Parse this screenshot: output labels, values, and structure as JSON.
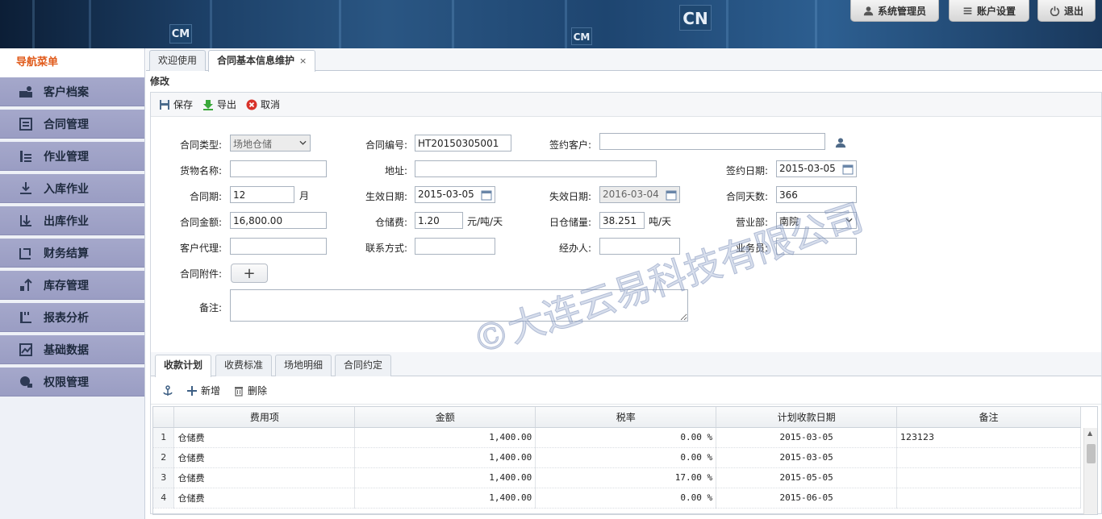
{
  "header": {
    "user_label": "系统管理员",
    "settings_label": "账户设置",
    "logout_label": "退出",
    "banner_marks": [
      "CN",
      "CM",
      "CM"
    ]
  },
  "sidebar": {
    "title": "导航菜单",
    "items": [
      {
        "label": "客户档案",
        "icon": "customer-icon"
      },
      {
        "label": "合同管理",
        "icon": "contract-icon"
      },
      {
        "label": "作业管理",
        "icon": "operation-icon"
      },
      {
        "label": "入库作业",
        "icon": "inbound-icon"
      },
      {
        "label": "出库作业",
        "icon": "outbound-icon"
      },
      {
        "label": "财务结算",
        "icon": "finance-icon"
      },
      {
        "label": "库存管理",
        "icon": "inventory-icon"
      },
      {
        "label": "报表分析",
        "icon": "report-icon"
      },
      {
        "label": "基础数据",
        "icon": "basedata-icon"
      },
      {
        "label": "权限管理",
        "icon": "permission-icon"
      }
    ]
  },
  "tabs": [
    {
      "label": "欢迎使用",
      "active": false
    },
    {
      "label": "合同基本信息维护",
      "active": true,
      "close": "×"
    }
  ],
  "panel_title": "修改",
  "toolbar": {
    "save": "保存",
    "export": "导出",
    "cancel": "取消"
  },
  "form": {
    "contract_type_label": "合同类型:",
    "contract_type_value": "场地仓储",
    "contract_no_label": "合同编号:",
    "contract_no_value": "HT20150305001",
    "customer_label": "签约客户:",
    "customer_value": "",
    "goods_label": "货物名称:",
    "goods_value": "",
    "address_label": "地址:",
    "address_value": "",
    "sign_date_label": "签约日期:",
    "sign_date_value": "2015-03-05",
    "period_label": "合同期:",
    "period_value": "12",
    "period_unit": "月",
    "effective_label": "生效日期:",
    "effective_value": "2015-03-05",
    "expire_label": "失效日期:",
    "expire_value": "2016-03-04",
    "days_label": "合同天数:",
    "days_value": "366",
    "amount_label": "合同金额:",
    "amount_value": "16,800.00",
    "fee_label": "仓储费:",
    "fee_value": "1.20",
    "fee_unit": "元/吨/天",
    "daily_label": "日仓储量:",
    "daily_value": "38.251",
    "daily_unit": "吨/天",
    "branch_label": "营业部:",
    "branch_value": "南院",
    "agent_label": "客户代理:",
    "agent_value": "",
    "contact_label": "联系方式:",
    "contact_value": "",
    "handler_label": "经办人:",
    "handler_value": "",
    "salesman_label": "业务员:",
    "salesman_value": "",
    "attachment_label": "合同附件:",
    "attachment_button": "+",
    "remark_label": "备注:",
    "remark_value": ""
  },
  "subtabs": [
    {
      "label": "收款计划",
      "active": true
    },
    {
      "label": "收费标准",
      "active": false
    },
    {
      "label": "场地明细",
      "active": false
    },
    {
      "label": "合同约定",
      "active": false
    }
  ],
  "grid_toolbar": {
    "add": "新增",
    "delete": "删除"
  },
  "grid": {
    "columns": [
      "费用项",
      "金额",
      "税率",
      "计划收款日期",
      "备注"
    ],
    "rows": [
      {
        "n": "1",
        "item": "仓储费",
        "amount": "1,400.00",
        "tax": "0.00 %",
        "date": "2015-03-05",
        "note": "123123"
      },
      {
        "n": "2",
        "item": "仓储费",
        "amount": "1,400.00",
        "tax": "0.00 %",
        "date": "2015-03-05",
        "note": ""
      },
      {
        "n": "3",
        "item": "仓储费",
        "amount": "1,400.00",
        "tax": "17.00 %",
        "date": "2015-05-05",
        "note": ""
      },
      {
        "n": "4",
        "item": "仓储费",
        "amount": "1,400.00",
        "tax": "0.00 %",
        "date": "2015-06-05",
        "note": ""
      }
    ]
  },
  "watermark": "©大连云易科技有限公司"
}
